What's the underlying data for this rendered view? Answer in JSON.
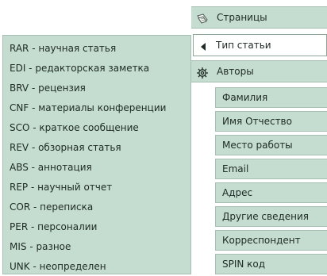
{
  "nav": {
    "pages_label": "Страницы",
    "article_type_label": "Тип статьи",
    "authors_label": "Авторы",
    "author_fields": [
      "Фамилия",
      "Имя Отчество",
      "Место работы",
      "Email",
      "Адрес",
      "Другие сведения",
      "Корреспондент",
      "SPIN код"
    ]
  },
  "article_types": [
    "RAR - научная статья",
    "EDI - редакторская заметка",
    "BRV - рецензия",
    "CNF - материалы конференции",
    "SCO - краткое сообщение",
    "REV - обзорная статья",
    "ABS - аннотация",
    "REP - научный отчет",
    "COR - переписка",
    "PER - персоналии",
    "MIS - разное",
    "UNK - неопределен"
  ],
  "icons": {
    "pages": "pages-icon",
    "article_type": "triangle-left-icon",
    "authors": "gear-icon"
  },
  "colors": {
    "panel": "#c5ddd0",
    "border": "#a6bfb2",
    "text": "#1e2a24"
  }
}
